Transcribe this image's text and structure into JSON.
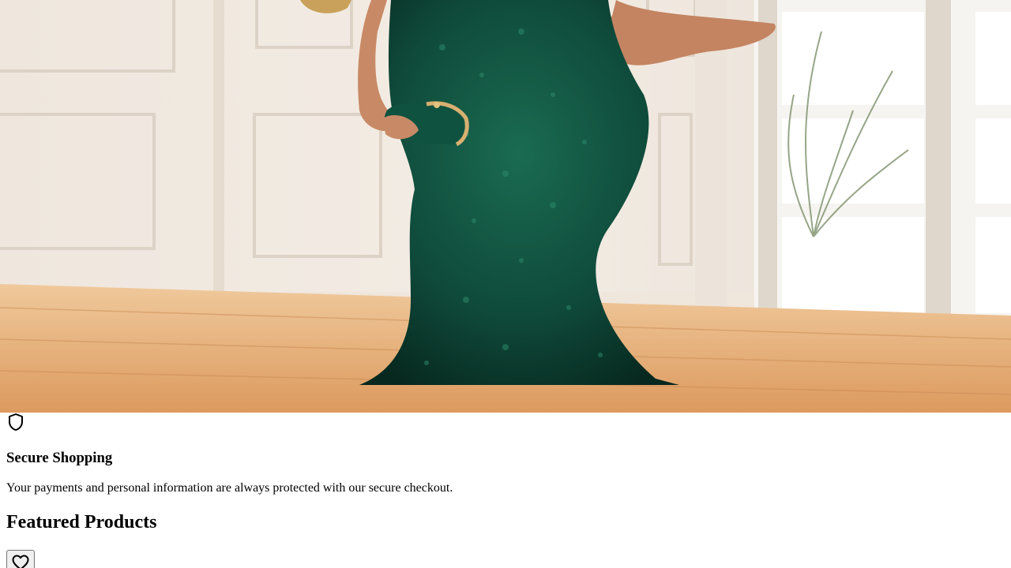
{
  "hero": {
    "image_subject": "model-in-emerald-sequin-mermaid-gown",
    "colors": {
      "gown": "#0f4a3a",
      "wall": "#efe6dc",
      "floor": "#e2a56d"
    }
  },
  "trust": {
    "icon": "shield-icon",
    "title": "Secure Shopping",
    "description": "Your payments and personal information are always protected with our secure checkout."
  },
  "featured": {
    "heading": "Featured Products",
    "wishlist_icon": "heart-icon"
  }
}
